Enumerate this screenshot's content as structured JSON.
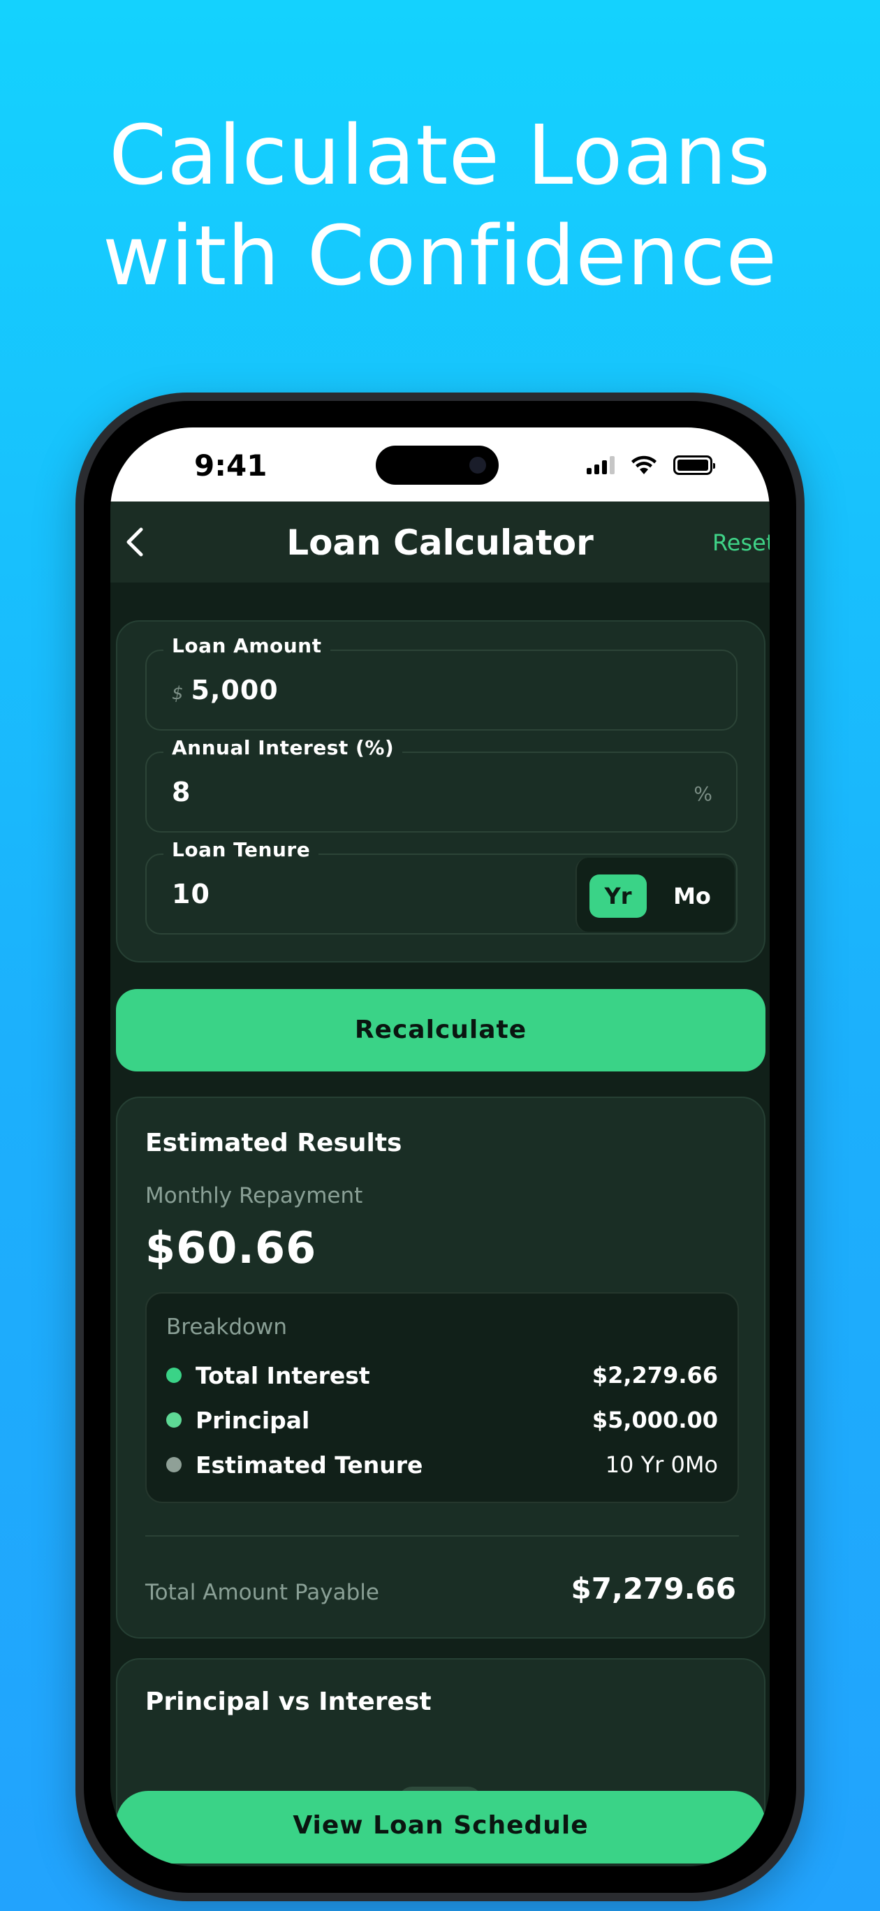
{
  "headline": {
    "line1": "Calculate Loans",
    "line2": "with Confidence"
  },
  "status_bar": {
    "time": "9:41"
  },
  "app_bar": {
    "title": "Loan Calculator",
    "reset_label": "Reset"
  },
  "inputs": {
    "loan_amount": {
      "label": "Loan Amount",
      "prefix": "$",
      "value": "5,000"
    },
    "annual_interest": {
      "label": "Annual Interest (%)",
      "value": "8",
      "suffix": "%"
    },
    "loan_tenure": {
      "label": "Loan Tenure",
      "value": "10",
      "unit_options": [
        "Yr",
        "Mo"
      ],
      "selected_unit": "Yr"
    }
  },
  "recalculate_label": "Recalculate",
  "results": {
    "title": "Estimated Results",
    "monthly_label": "Monthly Repayment",
    "monthly_value": "$60.66",
    "breakdown": {
      "title": "Breakdown",
      "rows": [
        {
          "label": "Total Interest",
          "value": "$2,279.66",
          "dot_color": "#3ad387"
        },
        {
          "label": "Principal",
          "value": "$5,000.00",
          "dot_color": "#5ed995"
        },
        {
          "label": "Estimated Tenure",
          "value": "10 Yr 0Mo",
          "dot_color": "#8fa097"
        }
      ]
    },
    "total_label": "Total Amount Payable",
    "total_value": "$7,279.66"
  },
  "chart_section": {
    "title": "Principal vs Interest"
  },
  "schedule_button_label": "View Loan Schedule",
  "colors": {
    "accent": "#3ad387",
    "background_top": "#14d2fe",
    "background_bottom": "#22a3fd",
    "screen_bg": "#112019",
    "card_bg": "#1a2e25"
  }
}
